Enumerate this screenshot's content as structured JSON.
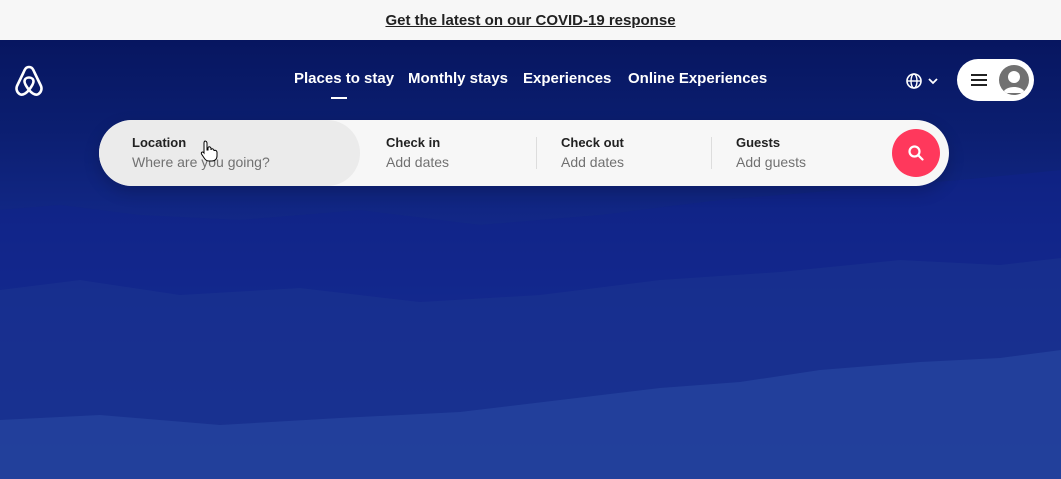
{
  "banner": {
    "link_text": "Get the latest on our COVID-19 response"
  },
  "header": {
    "logo_icon": "airbnb-logo-icon",
    "nav": [
      {
        "label": "Places to stay",
        "active": true
      },
      {
        "label": "Monthly stays"
      },
      {
        "label": "Experiences"
      },
      {
        "label": "Online Experiences"
      }
    ],
    "language_icon": "globe-icon",
    "menu_icon": "hamburger-menu-icon",
    "avatar_icon": "user-avatar-icon"
  },
  "search": {
    "location": {
      "label": "Location",
      "placeholder": "Where are you going?"
    },
    "check_in": {
      "label": "Check in",
      "value": "Add dates"
    },
    "check_out": {
      "label": "Check out",
      "value": "Add dates"
    },
    "guests": {
      "label": "Guests",
      "value": "Add guests"
    },
    "button_icon": "search-icon"
  },
  "colors": {
    "brand": "#ff385c",
    "hero_dark": "#071660",
    "hero_light": "#22439f",
    "banner_bg": "#f7f7f7"
  }
}
